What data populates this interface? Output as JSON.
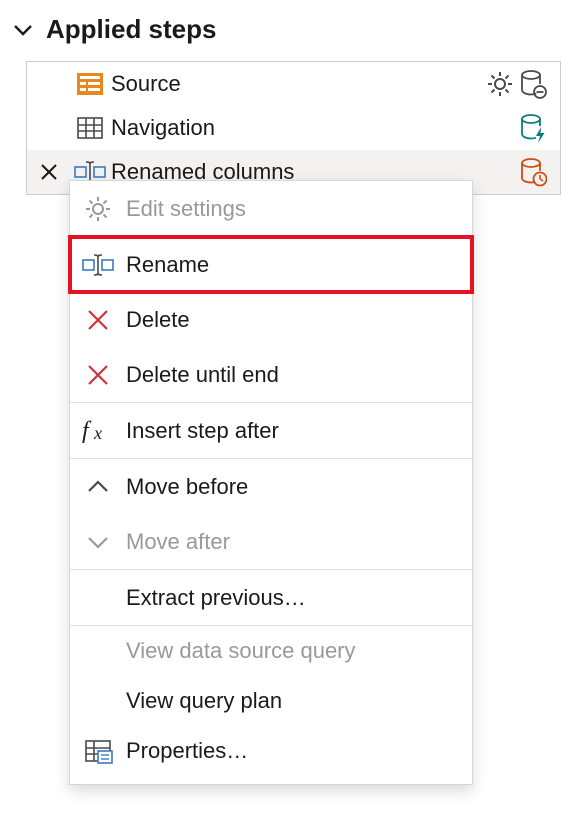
{
  "header": {
    "title": "Applied steps"
  },
  "steps": [
    {
      "label": "Source"
    },
    {
      "label": "Navigation"
    },
    {
      "label": "Renamed columns"
    }
  ],
  "menu": {
    "edit_settings": "Edit settings",
    "rename": "Rename",
    "delete": "Delete",
    "delete_until_end": "Delete until end",
    "insert_step_after": "Insert step after",
    "move_before": "Move before",
    "move_after": "Move after",
    "extract_previous": "Extract previous…",
    "view_data_source_query": "View data source query",
    "view_query_plan": "View query plan",
    "properties": "Properties…"
  }
}
